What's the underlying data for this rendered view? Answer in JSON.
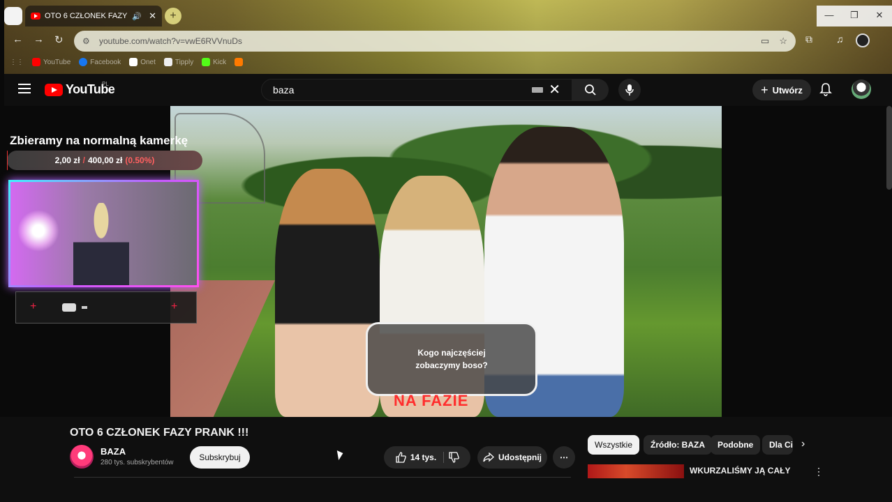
{
  "browser": {
    "tab_title": "OTO 6 CZŁONEK FAZY PRANK !!!",
    "url": "youtube.com/watch?v=vwE6RVVnuDs",
    "bookmarks": [
      {
        "label": "YouTube",
        "color": "#ff0000"
      },
      {
        "label": "Facebook",
        "color": "#1877f2"
      },
      {
        "label": "Onet",
        "color": "#ffffff"
      },
      {
        "label": "Tipply",
        "color": "#ffffff"
      },
      {
        "label": "Kick",
        "color": "#53fc18"
      },
      {
        "label": "",
        "color": "#ff7a00"
      }
    ],
    "window_buttons": {
      "minimize": "—",
      "restore": "❐",
      "close": "✕"
    }
  },
  "youtube": {
    "logo_text": "YouTube",
    "country": "PL",
    "search_value": "baza",
    "create_label": "Utwórz"
  },
  "overlay": {
    "goal_title": "Zbieramy na normalną kamerkę",
    "goal_current": "2,00 zł",
    "goal_separator": "/",
    "goal_target": "400,00 zł",
    "goal_percent": "(0.50%)",
    "goal_fraction": 0.005
  },
  "video": {
    "caption": "Kogo najczęściej zobaczymy boso?",
    "brand_text": "NA FAZIE"
  },
  "below": {
    "title": "OTO 6 CZŁONEK FAZY PRANK !!!",
    "channel": "BAZA",
    "subscribers": "280 tys. subskrybentów",
    "subscribe_label": "Subskrybuj",
    "likes": "14 tys.",
    "share_label": "Udostępnij",
    "chips": [
      "Wszystkie",
      "Źródło: BAZA",
      "Podobne",
      "Dla Ciebie"
    ],
    "recommended_title": "WKURZALIŚMY JĄ CAŁY"
  }
}
